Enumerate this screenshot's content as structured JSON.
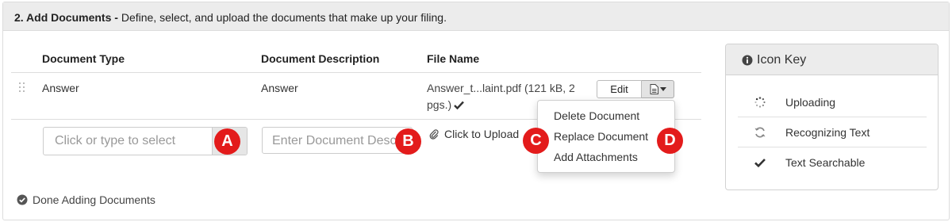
{
  "section": {
    "title_bold": "2. Add Documents -",
    "title_rest": " Define, select, and upload the documents that make up your filing."
  },
  "table": {
    "headers": [
      "Document Type",
      "Document Description",
      "File Name"
    ],
    "row": {
      "document_type": "Answer",
      "document_description": "Answer",
      "file_name_line1": "Answer_t...laint.pdf (121 kB, 2",
      "file_name_line2": "pgs.)",
      "edit_label": "Edit"
    }
  },
  "dropdown": {
    "items": [
      "Delete Document",
      "Replace Document",
      "Add Attachments"
    ]
  },
  "new_row": {
    "type_placeholder": "Click or type to select",
    "description_placeholder": "Enter Document Description",
    "upload_label": "Click to Upload"
  },
  "callouts": [
    "A",
    "B",
    "C",
    "D"
  ],
  "icon_key": {
    "title": "Icon Key",
    "items": [
      {
        "icon": "spinner-icon",
        "label": "Uploading"
      },
      {
        "icon": "refresh-icon",
        "label": "Recognizing Text"
      },
      {
        "icon": "checkmark-icon",
        "label": "Text Searchable"
      }
    ]
  },
  "footer": {
    "done_label": "Done Adding Documents"
  },
  "colors": {
    "callout_red": "#e31b1b",
    "header_bg": "#ececec"
  }
}
